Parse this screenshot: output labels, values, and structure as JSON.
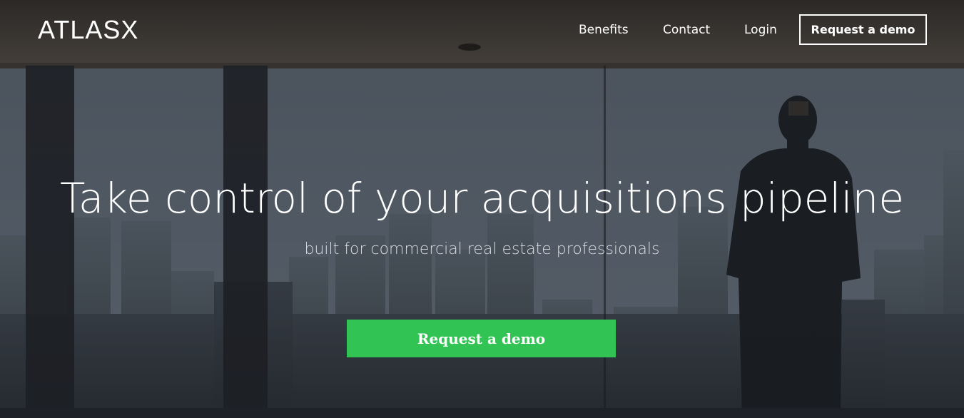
{
  "brand": {
    "logo_text": "ATLASX"
  },
  "nav": {
    "links": [
      {
        "label": "Benefits"
      },
      {
        "label": "Contact"
      },
      {
        "label": "Login"
      }
    ],
    "demo_button_label": "Request a demo"
  },
  "hero": {
    "headline": "Take control of your acquisitions pipeline",
    "subheadline": "built for commercial real estate professionals",
    "cta_label": "Request a demo"
  },
  "colors": {
    "cta_green": "#31c354",
    "text_white": "#ffffff",
    "background_dark": "#2b3036"
  }
}
